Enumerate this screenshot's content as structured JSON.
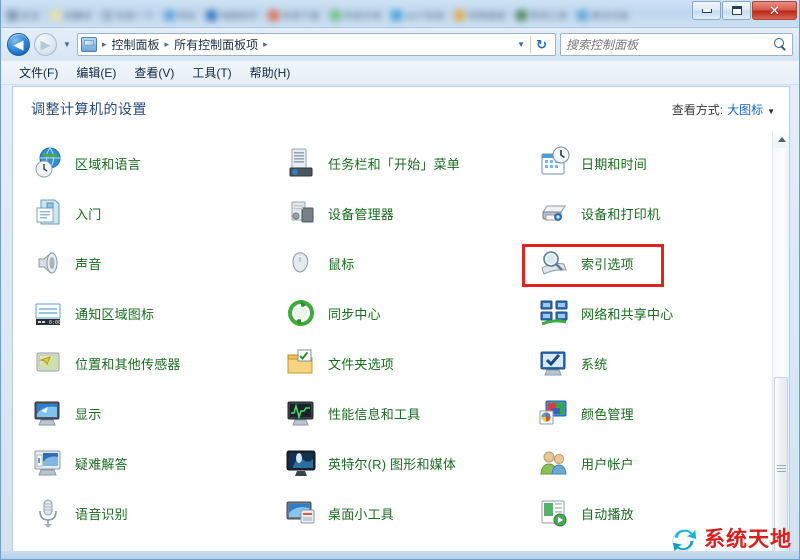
{
  "window": {
    "controls": {
      "minimize_label": "最小化",
      "maximize_label": "还原",
      "close_label": "关闭"
    },
    "tabs": [
      {
        "text": "安全",
        "color": "#7a8fa3"
      },
      {
        "text": "收藏夹",
        "color": "#f0e2a0"
      },
      {
        "text": "百度一下",
        "color": "#9ab0c4"
      },
      {
        "text": "网址",
        "color": "#5aa0e0"
      },
      {
        "text": "电脑软件",
        "color": "#2f6fb5"
      },
      {
        "text": "系统下载",
        "color": "#e0694a"
      },
      {
        "text": "系统天地",
        "color": "#6fbf7a"
      },
      {
        "text": "win7系统",
        "color": "#3a9fd8"
      },
      {
        "text": "控制面板",
        "color": "#e8a83c"
      },
      {
        "text": "常用工具",
        "color": "#4a7f4a"
      },
      {
        "text": "更多内容",
        "color": "#5a9fd4"
      }
    ]
  },
  "navbar": {
    "back_label": "后退",
    "forward_label": "前进",
    "history_label": "最近浏览的位置",
    "address_icon": "control-panel-icon",
    "breadcrumbs": [
      "控制面板",
      "所有控制面板项"
    ],
    "separator": "▸",
    "dropdown_caret": "▼",
    "refresh_label": "刷新",
    "refresh_glyph": "↻"
  },
  "search": {
    "placeholder": "搜索控制面板",
    "value": "",
    "icon": "search-icon"
  },
  "menubar": {
    "items": [
      "文件(F)",
      "编辑(E)",
      "查看(V)",
      "工具(T)",
      "帮助(H)"
    ]
  },
  "header": {
    "title": "调整计算机的设置",
    "view_by_label": "查看方式:",
    "view_by_value": "大图标",
    "view_by_caret": "▼"
  },
  "grid": {
    "rows": [
      [
        {
          "label": "",
          "icon": "globe-partial-icon",
          "partial": true,
          "accent": "#3f9a45"
        },
        {
          "label": "",
          "icon": "shield-partial-icon",
          "partial": true,
          "accent": "#d9b63c"
        },
        {
          "label": "",
          "icon": "folder-partial-icon",
          "partial": true,
          "accent": "#2c56a8"
        }
      ],
      [
        {
          "label": "区域和语言",
          "icon": "region-language-icon",
          "accent": "#2f8fd0"
        },
        {
          "label": "任务栏和「开始」菜单",
          "icon": "taskbar-start-menu-icon",
          "accent": "#6b6b6b"
        },
        {
          "label": "日期和时间",
          "icon": "date-time-icon",
          "accent": "#4a9fd4"
        }
      ],
      [
        {
          "label": "入门",
          "icon": "getting-started-icon",
          "accent": "#8fc4dd"
        },
        {
          "label": "设备管理器",
          "icon": "device-manager-icon",
          "accent": "#9aa3ab"
        },
        {
          "label": "设备和打印机",
          "icon": "devices-printers-icon",
          "accent": "#8e9aa6"
        }
      ],
      [
        {
          "label": "声音",
          "icon": "sound-icon",
          "accent": "#9fa6ad"
        },
        {
          "label": "鼠标",
          "icon": "mouse-icon",
          "accent": "#a8aeb5"
        },
        {
          "label": "索引选项",
          "icon": "indexing-options-icon",
          "accent": "#8f9aa6",
          "highlight": true
        }
      ],
      [
        {
          "label": "通知区域图标",
          "icon": "notification-area-icons-icon",
          "accent": "#5b9bd5"
        },
        {
          "label": "同步中心",
          "icon": "sync-center-icon",
          "accent": "#3faa3f"
        },
        {
          "label": "网络和共享中心",
          "icon": "network-sharing-center-icon",
          "accent": "#2f6fb5"
        }
      ],
      [
        {
          "label": "位置和其他传感器",
          "icon": "location-sensors-icon",
          "accent": "#d7c23a"
        },
        {
          "label": "文件夹选项",
          "icon": "folder-options-icon",
          "accent": "#e8b64c"
        },
        {
          "label": "系统",
          "icon": "system-icon",
          "accent": "#2f6fb5"
        }
      ],
      [
        {
          "label": "显示",
          "icon": "display-icon",
          "accent": "#2f7fc8"
        },
        {
          "label": "性能信息和工具",
          "icon": "performance-info-tools-icon",
          "accent": "#2f8f3f"
        },
        {
          "label": "颜色管理",
          "icon": "color-management-icon",
          "accent": "#3f8fd0"
        }
      ],
      [
        {
          "label": "疑难解答",
          "icon": "troubleshooting-icon",
          "accent": "#3f7fc0"
        },
        {
          "label": "英特尔(R) 图形和媒体",
          "icon": "intel-graphics-media-icon",
          "accent": "#1f3f6f"
        },
        {
          "label": "用户帐户",
          "icon": "user-accounts-icon",
          "accent": "#7aa84a"
        }
      ],
      [
        {
          "label": "语音识别",
          "icon": "speech-recognition-icon",
          "accent": "#9aa3ab"
        },
        {
          "label": "桌面小工具",
          "icon": "desktop-gadgets-icon",
          "accent": "#3f8fd0"
        },
        {
          "label": "自动播放",
          "icon": "autoplay-icon",
          "accent": "#4a9a5a"
        }
      ]
    ]
  },
  "scrollbar": {
    "up_label": "向上滚动",
    "thumb_label": "滚动条滑块"
  },
  "watermark": {
    "text": "系统天地",
    "logo": "recycle-arrow-logo"
  },
  "colors": {
    "highlight_red": "#e02222",
    "item_label_green": "#1a6a1f",
    "title_blue": "#2a4b77",
    "link_blue": "#1566c0",
    "watermark_red": "#d81f1f"
  }
}
